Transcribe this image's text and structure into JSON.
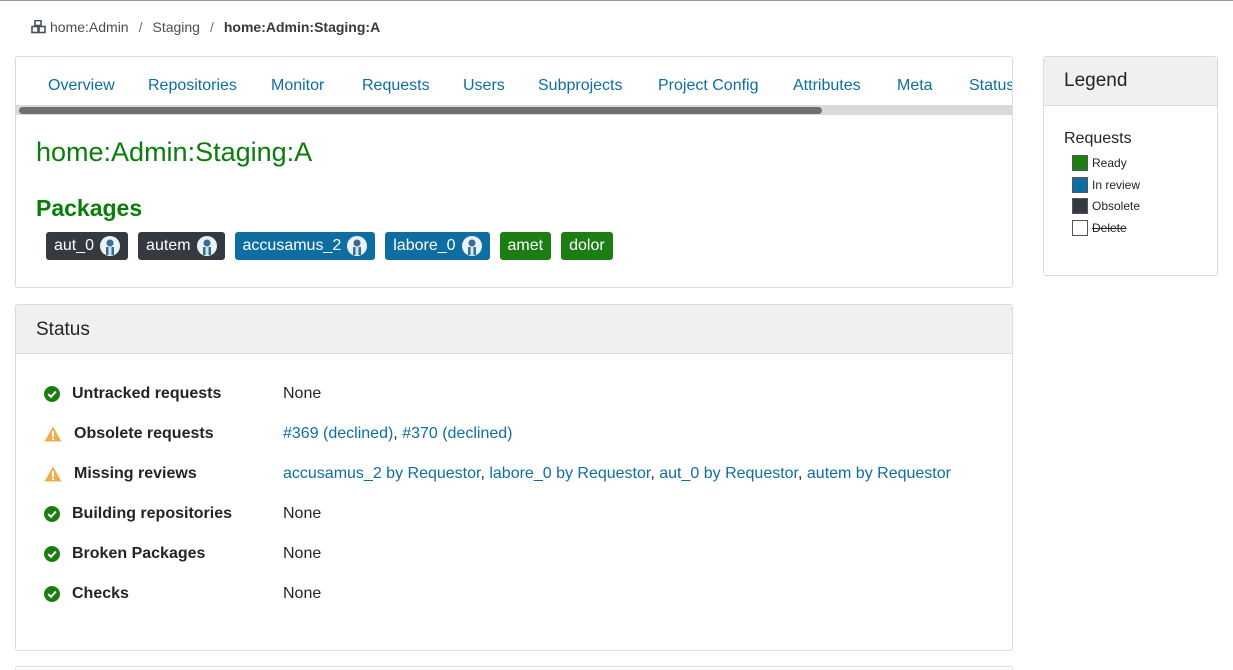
{
  "breadcrumb": {
    "items": [
      "home:Admin",
      "Staging"
    ],
    "current": "home:Admin:Staging:A"
  },
  "tabs": [
    "Overview",
    "Repositories",
    "Monitor",
    "Requests",
    "Users",
    "Subprojects",
    "Project Config",
    "Attributes",
    "Meta",
    "Status"
  ],
  "project": {
    "title": "home:Admin:Staging:A",
    "packages_heading": "Packages",
    "packages": [
      {
        "name": "aut_0",
        "state": "obsolete",
        "avatar": true
      },
      {
        "name": "autem",
        "state": "obsolete",
        "avatar": true
      },
      {
        "name": "accusamus_2",
        "state": "review",
        "avatar": true
      },
      {
        "name": "labore_0",
        "state": "review",
        "avatar": true
      },
      {
        "name": "amet",
        "state": "ready",
        "avatar": false
      },
      {
        "name": "dolor",
        "state": "ready",
        "avatar": false
      }
    ]
  },
  "status": {
    "heading": "Status",
    "rows": [
      {
        "icon": "check-circle-icon",
        "label": "Untracked requests",
        "value": "None"
      },
      {
        "icon": "warning-icon",
        "label": "Obsolete requests",
        "links": [
          "#369 (declined)",
          "#370 (declined)"
        ]
      },
      {
        "icon": "warning-icon",
        "label": "Missing reviews",
        "links": [
          "accusamus_2 by Requestor",
          "labore_0 by Requestor",
          "aut_0 by Requestor",
          "autem by Requestor"
        ]
      },
      {
        "icon": "check-circle-icon",
        "label": "Building repositories",
        "value": "None"
      },
      {
        "icon": "check-circle-icon",
        "label": "Broken Packages",
        "value": "None"
      },
      {
        "icon": "check-circle-icon",
        "label": "Checks",
        "value": "None"
      }
    ]
  },
  "legend": {
    "heading": "Legend",
    "subheading": "Requests",
    "items": [
      {
        "label": "Ready",
        "color": "#1b7d12"
      },
      {
        "label": "In review",
        "color": "#0e6ea1"
      },
      {
        "label": "Obsolete",
        "color": "#343a40"
      },
      {
        "label": "Delete",
        "color": "#ffffff"
      }
    ]
  },
  "colors": {
    "ready": "#1b7d12",
    "review": "#0e6ea1",
    "obsolete": "#343a40",
    "title_green": "#0a7d0a",
    "link": "#0e6ea1",
    "ok": "#1b7d12",
    "warn": "#f0ad4e"
  }
}
